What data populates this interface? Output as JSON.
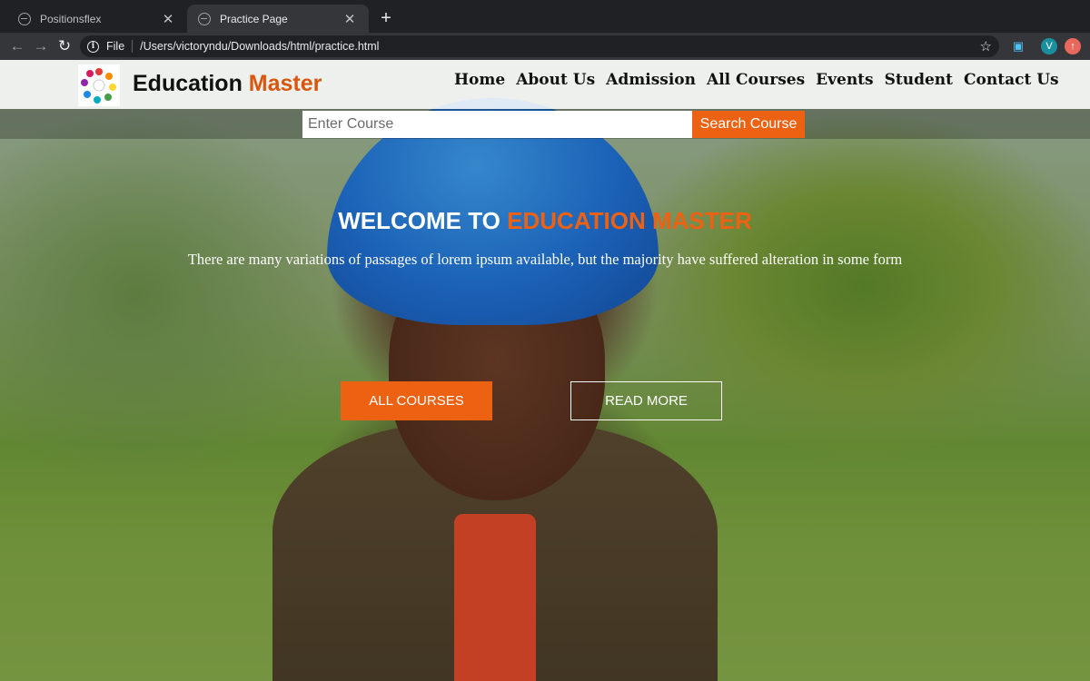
{
  "browser": {
    "tabs": [
      {
        "title": "Positionsflex",
        "active": false
      },
      {
        "title": "Practice Page",
        "active": true
      }
    ],
    "address": {
      "protocol": "File",
      "url": "/Users/victoryndu/Downloads/html/practice.html"
    },
    "profile_initial": "V",
    "icons": [
      "back-icon",
      "forward-icon",
      "reload-icon",
      "info-icon",
      "star-icon",
      "extension-icon",
      "profile-avatar",
      "update-icon"
    ]
  },
  "site": {
    "brand": {
      "name": "Education",
      "accent": "Master"
    },
    "nav": [
      "Home",
      "About Us",
      "Admission",
      "All Courses",
      "Events",
      "Student",
      "Contact Us"
    ],
    "search": {
      "placeholder": "Enter Course",
      "button": "Search Course"
    },
    "hero": {
      "title_prefix": "WELCOME TO",
      "title_accent": "EDUCATION MASTER",
      "subtitle": "There are many variations of passages of lorem ipsum available, but the majority have suffered alteration in some form",
      "primary_button": "ALL COURSES",
      "secondary_button": "READ MORE"
    },
    "colors": {
      "accent": "#ec6112",
      "header_bg": "#ffffff"
    }
  }
}
